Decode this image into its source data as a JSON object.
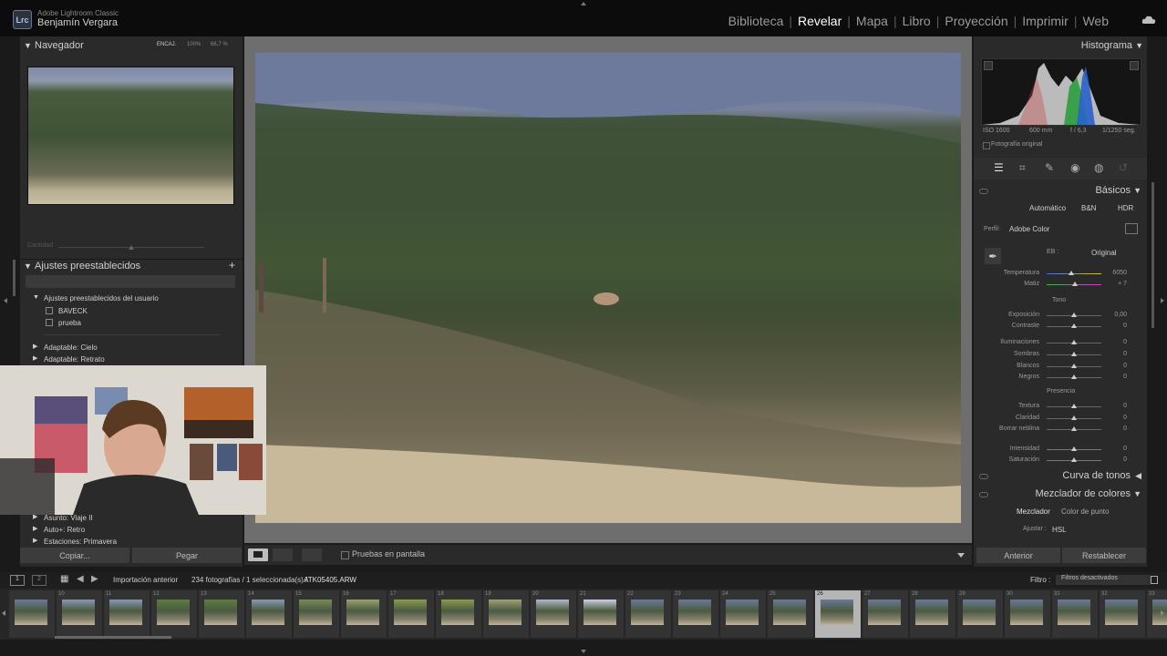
{
  "app": {
    "name": "Adobe Lightroom Classic",
    "user": "Benjamín Vergara",
    "logo": "Lrc"
  },
  "modules": [
    "Biblioteca",
    "Revelar",
    "Mapa",
    "Libro",
    "Proyección",
    "Imprimir",
    "Web"
  ],
  "active_module": "Revelar",
  "navigator": {
    "title": "Navegador",
    "fit": "ENCAJ.",
    "zoom1": "100%",
    "zoom2": "66,7 %"
  },
  "presets": {
    "title": "Ajustes preestablecidos",
    "amount_label": "Cantidad",
    "group_user": "Ajustes preestablecidos del usuario",
    "user_items": [
      "BAVECK",
      "prueba"
    ],
    "groups": [
      "Adaptable: Cielo",
      "Adaptable: Retrato",
      "Asunto: Viaje II",
      "Auto+: Retro",
      "Estaciones: Primavera"
    ]
  },
  "left_buttons": {
    "copy": "Copiar...",
    "paste": "Pegar"
  },
  "toolbar": {
    "soft_proof": "Pruebas en pantalla"
  },
  "histogram": {
    "title": "Histograma",
    "iso": "ISO 1600",
    "focal": "600 mm",
    "aperture": "f / 6,3",
    "shutter": "1/1250 seg.",
    "original_photo": "Fotografía original"
  },
  "basics": {
    "title": "Básicos",
    "modes": [
      "Automático",
      "B&N",
      "HDR"
    ],
    "profile_label": "Perfil:",
    "profile_value": "Adobe Color",
    "wb_label": "EB :",
    "wb_value": "Original",
    "tone_label": "Tono",
    "presence_label": "Presencia",
    "sliders": [
      {
        "label": "Temperatura",
        "value": "6050",
        "level": 0.45
      },
      {
        "label": "Matiz",
        "value": "+ 7",
        "level": 0.52
      },
      {
        "label": "Exposición",
        "value": "0,00",
        "level": 0.5
      },
      {
        "label": "Contraste",
        "value": "0",
        "level": 0.5
      },
      {
        "label": "Iluminaciones",
        "value": "0",
        "level": 0.5
      },
      {
        "label": "Sombras",
        "value": "0",
        "level": 0.5
      },
      {
        "label": "Blancos",
        "value": "0",
        "level": 0.5
      },
      {
        "label": "Negros",
        "value": "0",
        "level": 0.5
      },
      {
        "label": "Textura",
        "value": "0",
        "level": 0.5
      },
      {
        "label": "Claridad",
        "value": "0",
        "level": 0.5
      },
      {
        "label": "Borrar neblina",
        "value": "0",
        "level": 0.5
      },
      {
        "label": "Intensidad",
        "value": "0",
        "level": 0.5
      },
      {
        "label": "Saturación",
        "value": "0",
        "level": 0.5
      }
    ]
  },
  "tone_curve": {
    "title": "Curva de tonos"
  },
  "color_mixer": {
    "title": "Mezclador de colores",
    "tab1": "Mezclador",
    "tab2": "Color de punto",
    "adjust_label": "Ajustar :",
    "adjust_value": "HSL"
  },
  "right_buttons": {
    "previous": "Anterior",
    "reset": "Restablecer"
  },
  "filmbar": {
    "screen1": "1",
    "screen2": "2",
    "source": "Importación anterior",
    "count": "234 fotografías / 1 seleccionada(s) /",
    "filename": "ATK05405.ARW",
    "filter_label": "Filtro :",
    "filter_value": "Filtros desactivados"
  },
  "filmstrip": {
    "numbers": [
      "",
      "10",
      "11",
      "12",
      "13",
      "14",
      "15",
      "16",
      "17",
      "18",
      "19",
      "20",
      "21",
      "22",
      "23",
      "24",
      "25",
      "26",
      "27",
      "28",
      "29",
      "30",
      "31",
      "32",
      "33"
    ],
    "selected": "26"
  }
}
